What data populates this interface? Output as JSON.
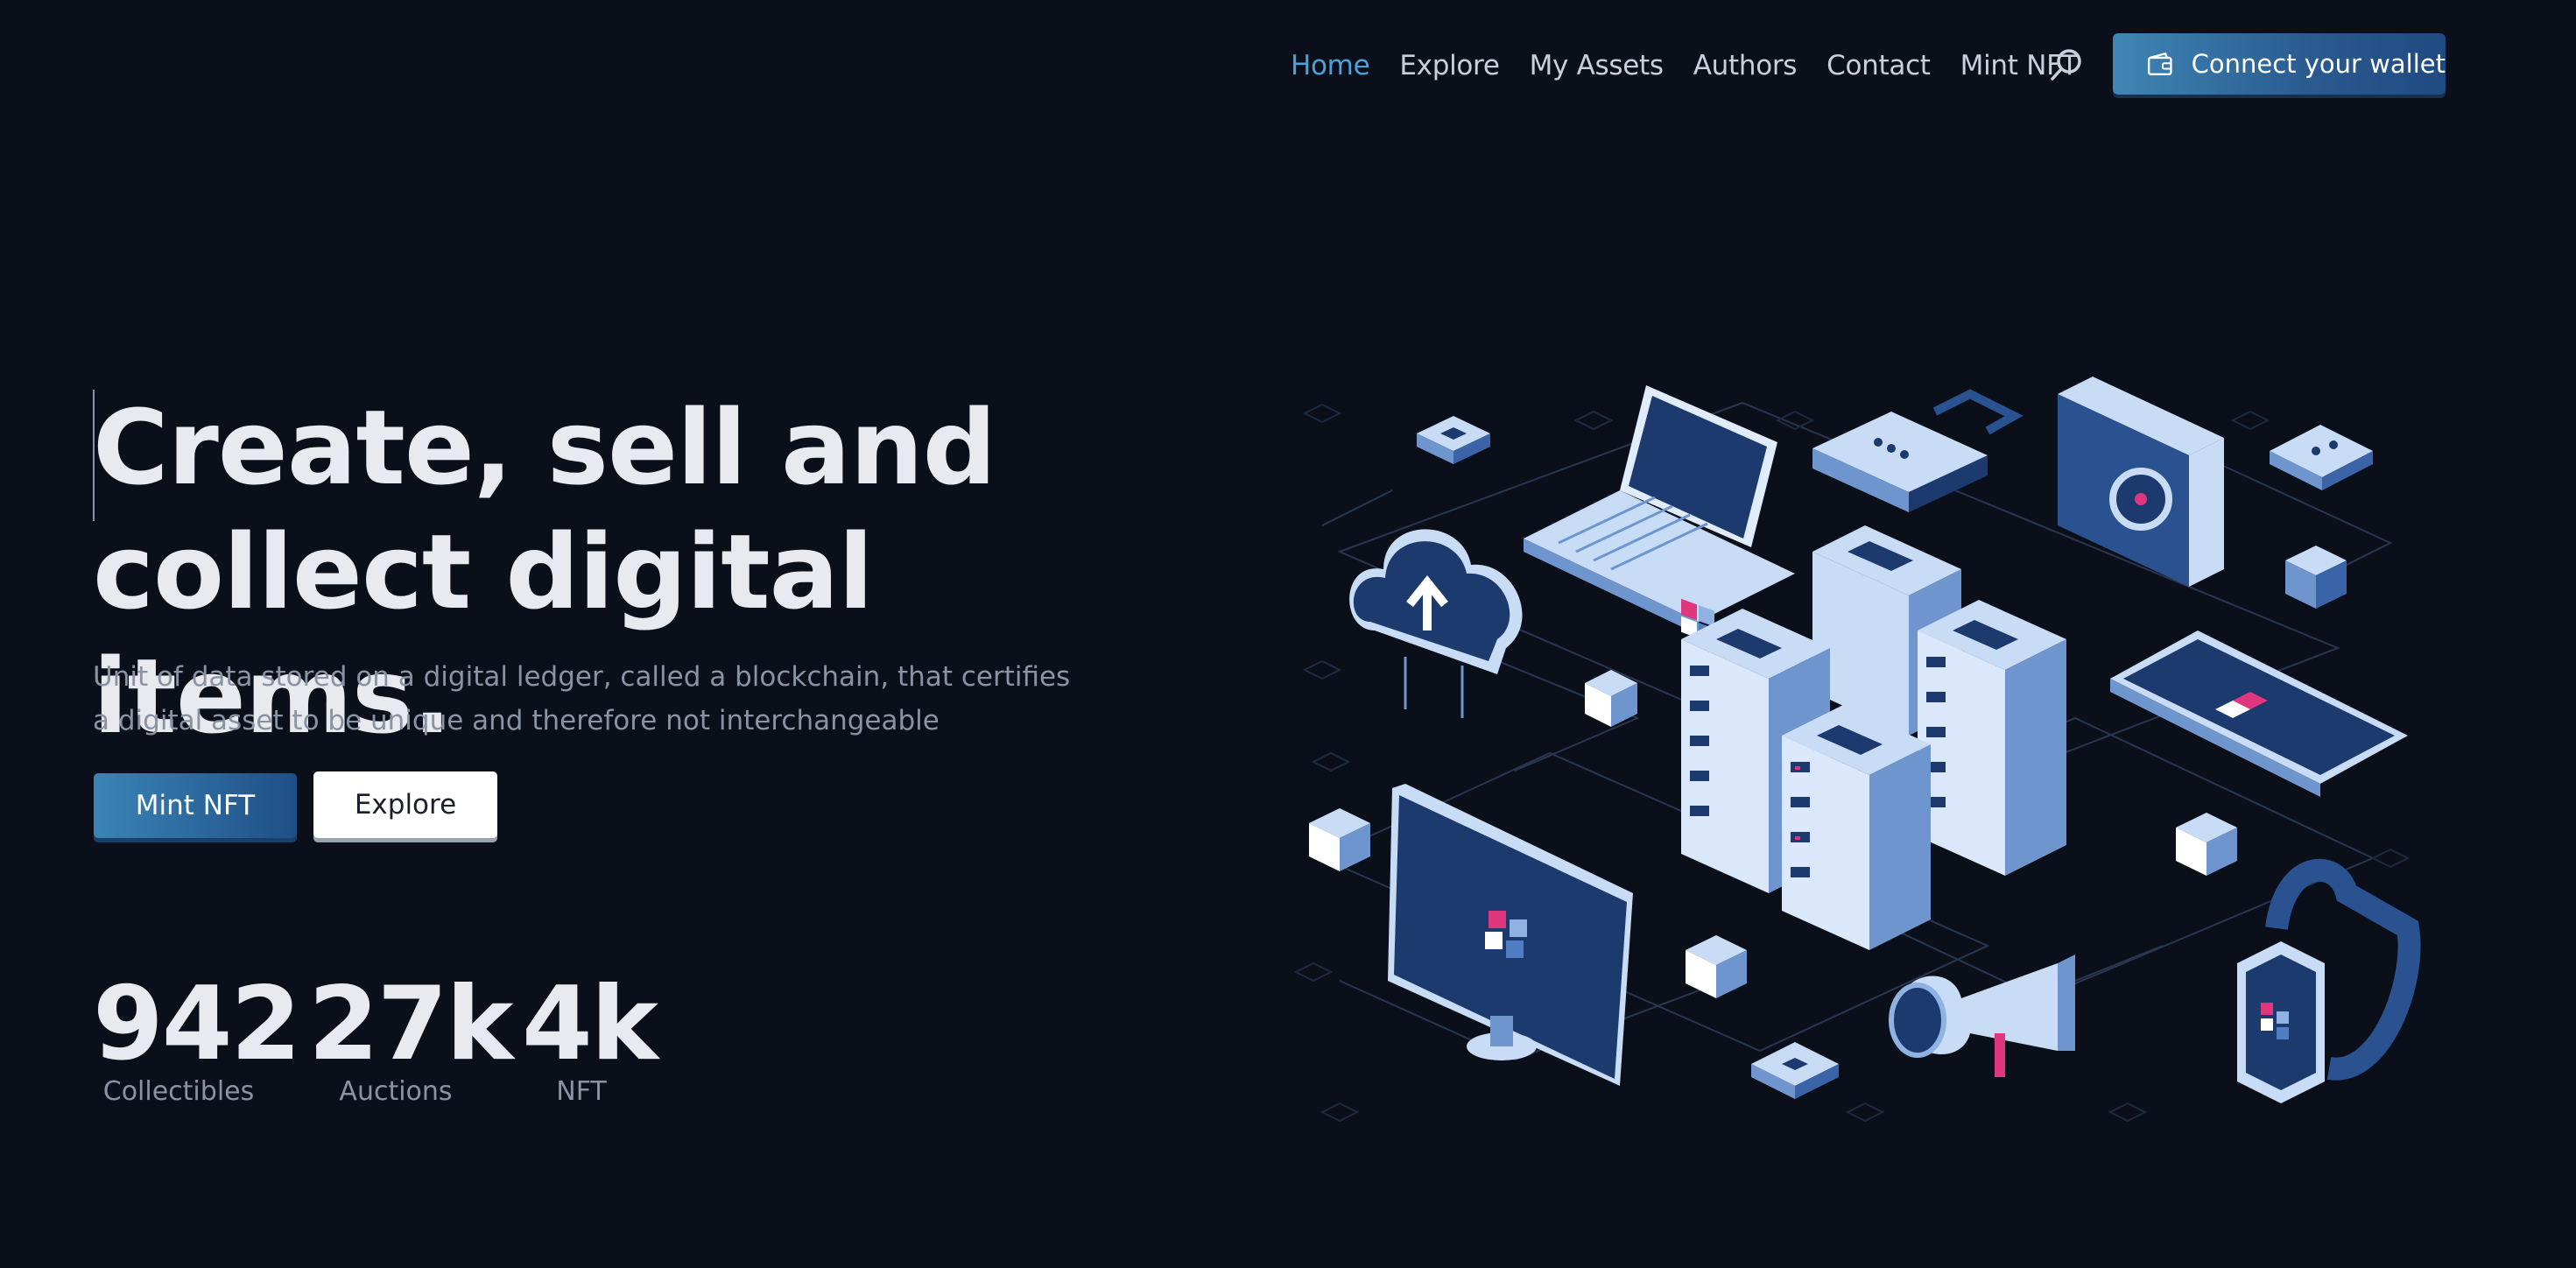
{
  "nav": {
    "links": [
      {
        "label": "Home",
        "active": true
      },
      {
        "label": "Explore",
        "active": false
      },
      {
        "label": "My Assets",
        "active": false
      },
      {
        "label": "Authors",
        "active": false
      },
      {
        "label": "Contact",
        "active": false
      },
      {
        "label": "Mint NFT",
        "active": false
      }
    ],
    "search_icon": "search-icon",
    "wallet_button": {
      "label": "Connect your wallet",
      "icon": "wallet-icon"
    }
  },
  "hero": {
    "title_line1": "Create, sell and",
    "title_line2": "collect digital items.",
    "subtitle": "Unit of data stored on a digital ledger, called a blockchain, that certifies a digital asset to be unique and therefore not interchangeable",
    "primary_button": "Mint NFT",
    "secondary_button": "Explore"
  },
  "stats": [
    {
      "value": "942",
      "label": "Collectibles"
    },
    {
      "value": "27k",
      "label": "Auctions"
    },
    {
      "value": "4k",
      "label": "NFT"
    }
  ],
  "colors": {
    "background": "#0b0f1a",
    "accent": "#4aa2d6",
    "brand_blue": "#2a5a8f",
    "illustration_dark": "#1c3a6e",
    "illustration_light": "#c9dcf5",
    "highlight_pink": "#e0367e"
  }
}
